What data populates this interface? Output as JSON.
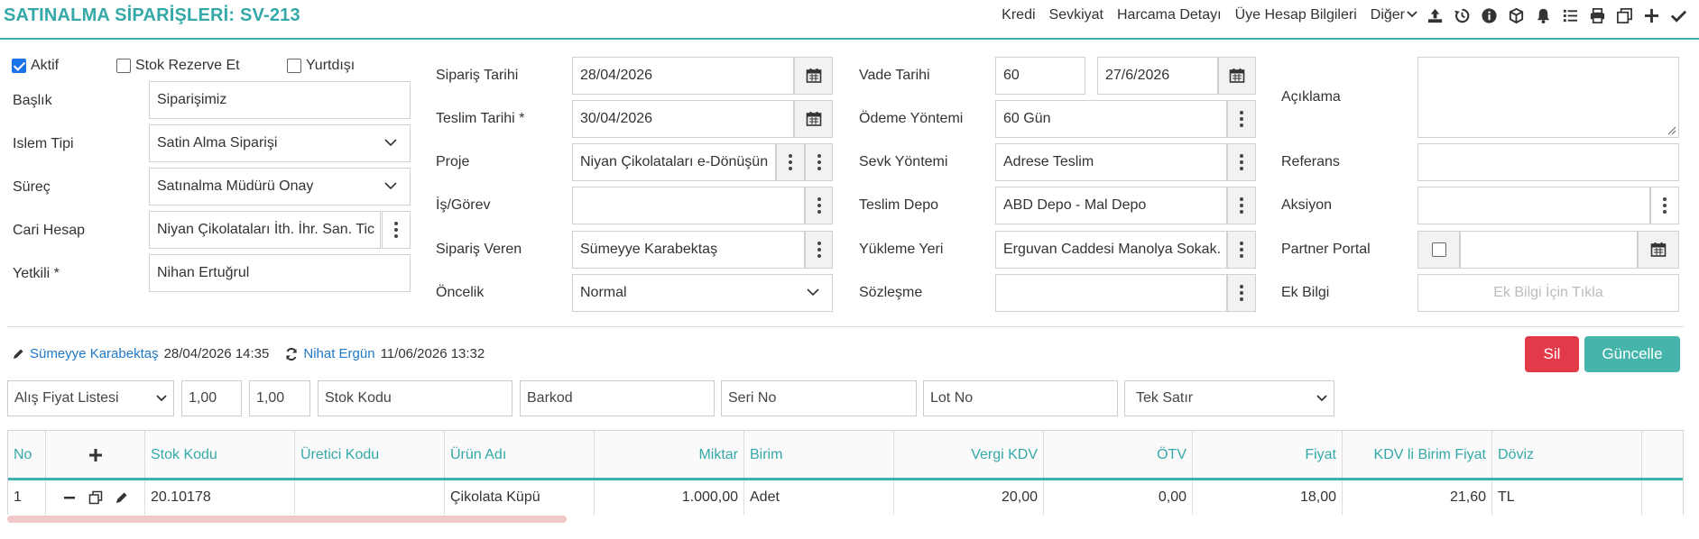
{
  "page_title": "SATINALMA SİPARİŞLERİ: SV-213",
  "top_links": [
    "Kredi",
    "Sevkiyat",
    "Harcama Detayı",
    "Üye Hesap Bilgileri",
    "Diğer"
  ],
  "top_icons": [
    "upload-icon",
    "history-icon",
    "info-icon",
    "box-icon",
    "bell-icon",
    "list-icon",
    "print-icon",
    "copy-icon",
    "plus-icon",
    "check-icon"
  ],
  "checks": {
    "aktif": "Aktif",
    "stok": "Stok Rezerve Et",
    "yurtdisi": "Yurtdışı",
    "aktif_checked": true
  },
  "col1": {
    "baslik_label": "Başlık",
    "baslik_value": "Siparişimiz",
    "islem_label": "Islem Tipi",
    "islem_value": "Satin Alma Siparişi",
    "surec_label": "Süreç",
    "surec_value": "Satınalma Müdürü Onay",
    "cari_label": "Cari Hesap",
    "cari_value": "Niyan Çikolataları İth. İhr. San. Tic",
    "yetkili_label": "Yetkili *",
    "yetkili_value": "Nihan Ertuğrul"
  },
  "col2": {
    "siparis_tarihi_label": "Sipariş Tarihi",
    "siparis_tarihi_value": "28/04/2026",
    "teslim_tarihi_label": "Teslim Tarihi *",
    "teslim_tarihi_value": "30/04/2026",
    "proje_label": "Proje",
    "proje_value": "Niyan Çikolataları e-Dönüşün",
    "is_label": "İş/Görev",
    "is_value": "",
    "veren_label": "Sipariş Veren",
    "veren_value": "Sümeyye Karabektaş",
    "oncelik_label": "Öncelik",
    "oncelik_value": "Normal"
  },
  "col3": {
    "vade_label": "Vade Tarihi",
    "vade_days": "60",
    "vade_date": "27/6/2026",
    "odeme_label": "Ödeme Yöntemi",
    "odeme_value": "60 Gün",
    "sevk_label": "Sevk Yöntemi",
    "sevk_value": "Adrese Teslim",
    "depo_label": "Teslim Depo",
    "depo_value": "ABD Depo - Mal Depo",
    "yukleme_label": "Yükleme Yeri",
    "yukleme_value": "Erguvan Caddesi Manolya Sokak.",
    "sozlesme_label": "Sözleşme",
    "sozlesme_value": ""
  },
  "col4": {
    "aciklama_label": "Açıklama",
    "referans_label": "Referans",
    "aksiyon_label": "Aksiyon",
    "partner_label": "Partner Portal",
    "ekbilgi_label": "Ek Bilgi",
    "ekbilgi_placeholder": "Ek Bilgi İçin Tıkla"
  },
  "meta": {
    "created_user": "Sümeyye Karabektaş",
    "created_at": "28/04/2026 14:35",
    "updated_user": "Nihat Ergün",
    "updated_at": "11/06/2026 13:32"
  },
  "buttons": {
    "delete": "Sil",
    "update": "Güncelle"
  },
  "filters": {
    "price_list": "Alış Fiyat Listesi",
    "val1": "1,00",
    "val2": "1,00",
    "stok_placeholder": "Stok Kodu",
    "barkod_placeholder": "Barkod",
    "seri_placeholder": "Seri No",
    "lot_placeholder": "Lot No",
    "mode": "Tek Satır"
  },
  "table": {
    "headers": [
      "No",
      "+",
      "Stok Kodu",
      "Üretici Kodu",
      "Ürün Adı",
      "Miktar",
      "Birim",
      "Vergi KDV",
      "ÖTV",
      "Fiyat",
      "KDV li Birim Fiyat",
      "Döviz"
    ],
    "rows": [
      {
        "no": "1",
        "stok": "20.10178",
        "uretici": "",
        "urun": "Çikolata Küpü",
        "miktar": "1.000,00",
        "birim": "Adet",
        "kdv": "20,00",
        "otv": "0,00",
        "fiyat": "18,00",
        "kdvli": "21,60",
        "doviz": "TL"
      }
    ]
  },
  "colors": {
    "accent": "#35a8a8",
    "delete": "#e33a4a",
    "update": "#45b5ac",
    "link": "#1f78c8"
  }
}
